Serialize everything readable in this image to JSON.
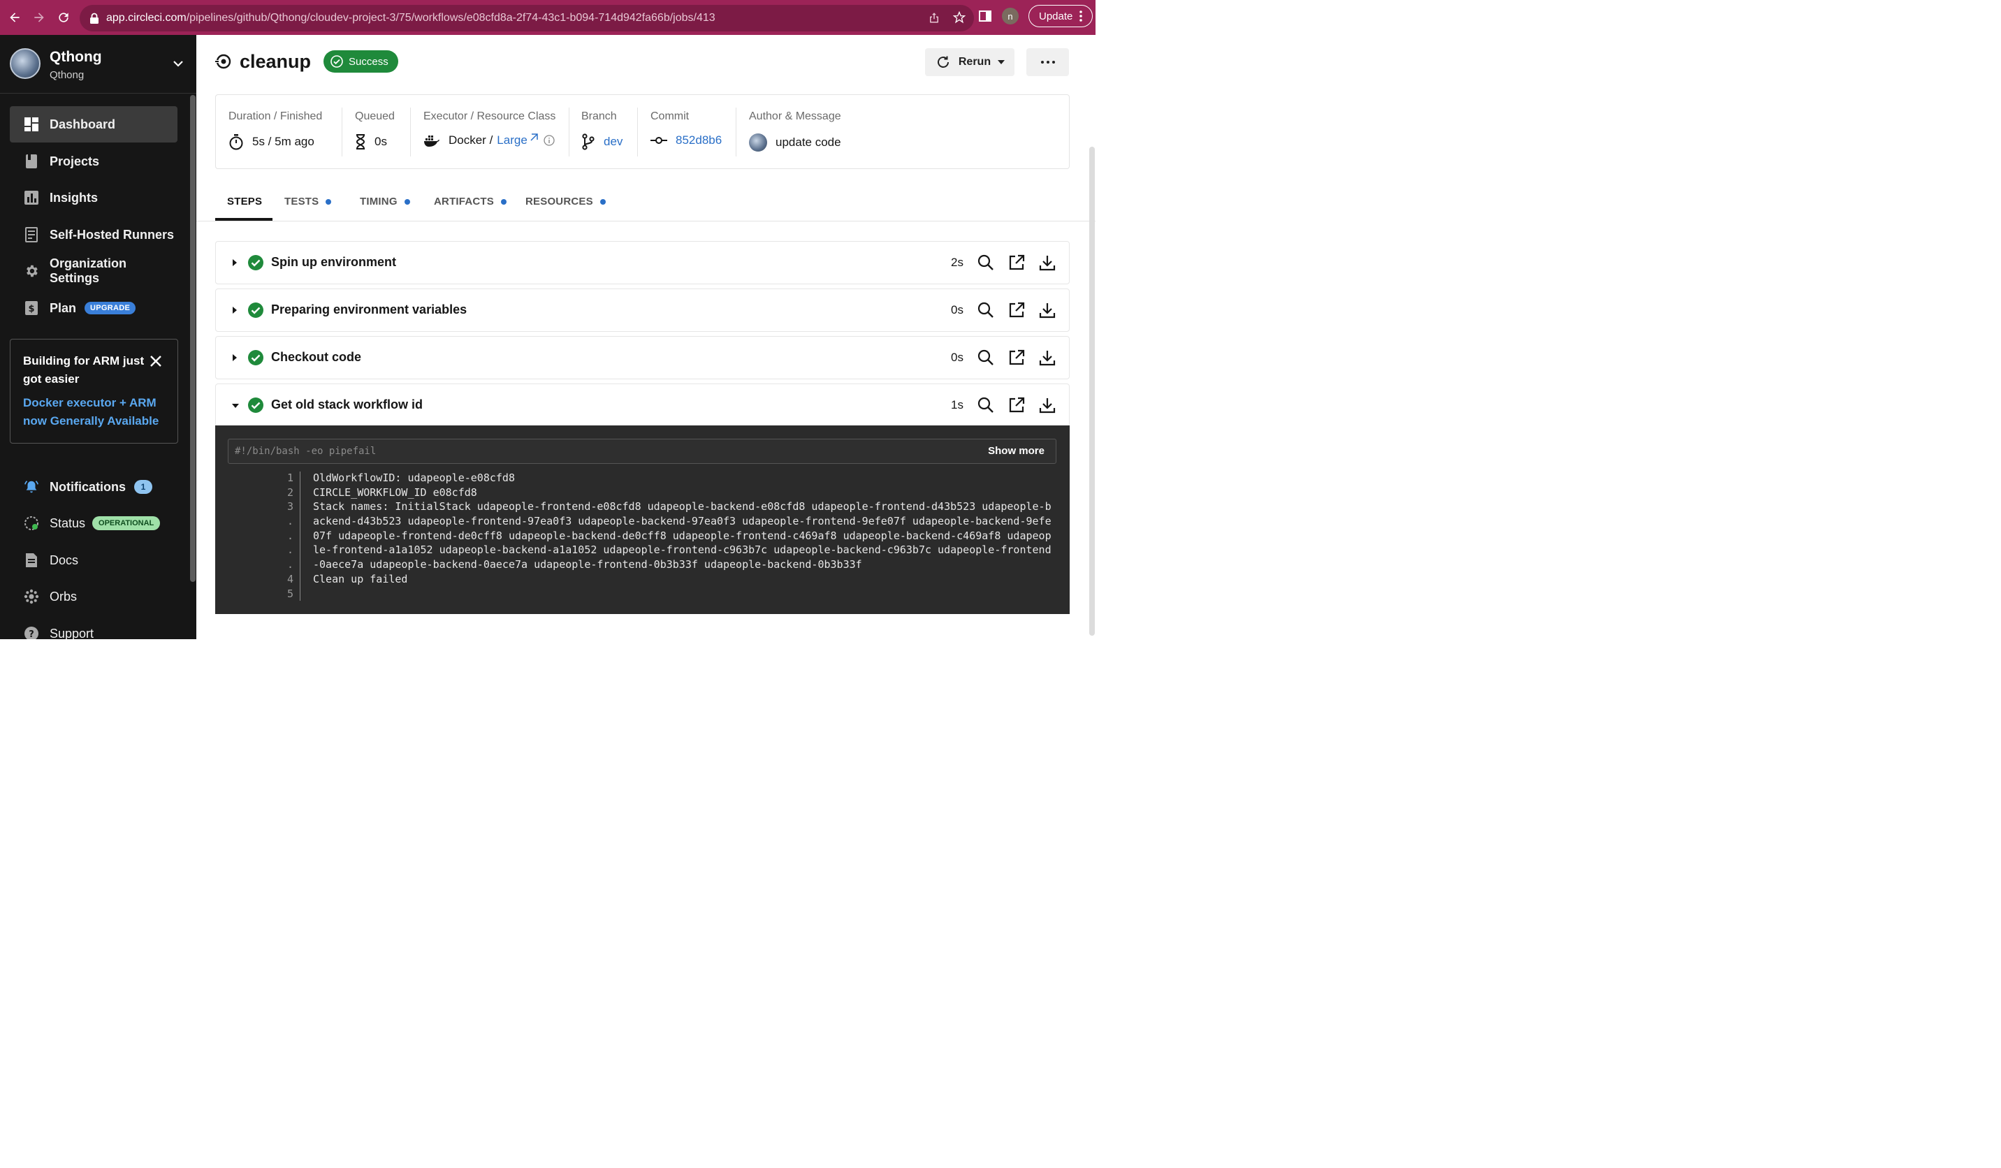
{
  "browser": {
    "url_host": "app.circleci.com",
    "url_path": "/pipelines/github/Qthong/cloudev-project-3/75/workflows/e08cfd8a-2f74-43c1-b094-714d942fa66b/jobs/413",
    "profile_initial": "n",
    "update_label": "Update"
  },
  "sidebar": {
    "org_name": "Qthong",
    "org_sub": "Qthong",
    "items": [
      {
        "label": "Dashboard",
        "icon": "dashboard-icon"
      },
      {
        "label": "Projects",
        "icon": "book-icon"
      },
      {
        "label": "Insights",
        "icon": "bar-chart-icon"
      },
      {
        "label": "Self-Hosted Runners",
        "icon": "runner-icon"
      },
      {
        "label": "Organization Settings",
        "icon": "gear-icon"
      },
      {
        "label": "Plan",
        "icon": "dollar-icon",
        "badge": "UPGRADE"
      }
    ],
    "promo": {
      "title": "Building for ARM just got easier",
      "link": "Docker executor + ARM now Generally Available"
    },
    "bottom_items": [
      {
        "label": "Notifications",
        "icon": "bell-icon",
        "badge": "1"
      },
      {
        "label": "Status",
        "icon": "status-icon",
        "badge": "OPERATIONAL"
      },
      {
        "label": "Docs",
        "icon": "docs-icon"
      },
      {
        "label": "Orbs",
        "icon": "orbs-icon"
      },
      {
        "label": "Support",
        "icon": "support-icon"
      }
    ]
  },
  "job": {
    "title": "cleanup",
    "status": "Success",
    "rerun_label": "Rerun"
  },
  "info": {
    "duration_header": "Duration / Finished",
    "duration_value": "5s / 5m ago",
    "queued_header": "Queued",
    "queued_value": "0s",
    "executor_header": "Executor / Resource Class",
    "executor_value": "Docker /",
    "resource_class": "Large",
    "branch_header": "Branch",
    "branch_value": "dev",
    "commit_header": "Commit",
    "commit_value": "852d8b6",
    "author_header": "Author & Message",
    "author_message": "update code"
  },
  "tabs": [
    {
      "label": "STEPS",
      "active": true
    },
    {
      "label": "TESTS",
      "dot": true
    },
    {
      "label": "TIMING",
      "dot": true
    },
    {
      "label": "ARTIFACTS",
      "dot": true
    },
    {
      "label": "RESOURCES",
      "dot": true
    }
  ],
  "steps": [
    {
      "name": "Spin up environment",
      "duration": "2s",
      "expanded": false
    },
    {
      "name": "Preparing environment variables",
      "duration": "0s",
      "expanded": false
    },
    {
      "name": "Checkout code",
      "duration": "0s",
      "expanded": false
    },
    {
      "name": "Get old stack workflow id",
      "duration": "1s",
      "expanded": true
    }
  ],
  "log": {
    "command": "#!/bin/bash -eo pipefail",
    "show_more": "Show more",
    "lines": [
      {
        "num": "1",
        "text": "OldWorkflowID: udapeople-e08cfd8"
      },
      {
        "num": "2",
        "text": "CIRCLE_WORKFLOW_ID e08cfd8"
      },
      {
        "num": "3",
        "text": "Stack names: InitialStack udapeople-frontend-e08cfd8 udapeople-backend-e08cfd8 udapeople-frontend-d43b523 udapeople-b"
      },
      {
        "num": ".",
        "text": "ackend-d43b523 udapeople-frontend-97ea0f3 udapeople-backend-97ea0f3 udapeople-frontend-9efe07f udapeople-backend-9efe"
      },
      {
        "num": ".",
        "text": "07f udapeople-frontend-de0cff8 udapeople-backend-de0cff8 udapeople-frontend-c469af8 udapeople-backend-c469af8 udapeop"
      },
      {
        "num": ".",
        "text": "le-frontend-a1a1052 udapeople-backend-a1a1052 udapeople-frontend-c963b7c udapeople-backend-c963b7c udapeople-frontend"
      },
      {
        "num": ".",
        "text": "-0aece7a udapeople-backend-0aece7a udapeople-frontend-0b3b33f udapeople-backend-0b3b33f"
      },
      {
        "num": "4",
        "text": "Clean up failed"
      },
      {
        "num": "5",
        "text": ""
      }
    ]
  },
  "colors": {
    "browser_bar": "#9c2357",
    "sidebar": "#161616",
    "success": "#1f8a3b",
    "link": "#2a6fc7",
    "log_bg": "#2b2b2b"
  }
}
